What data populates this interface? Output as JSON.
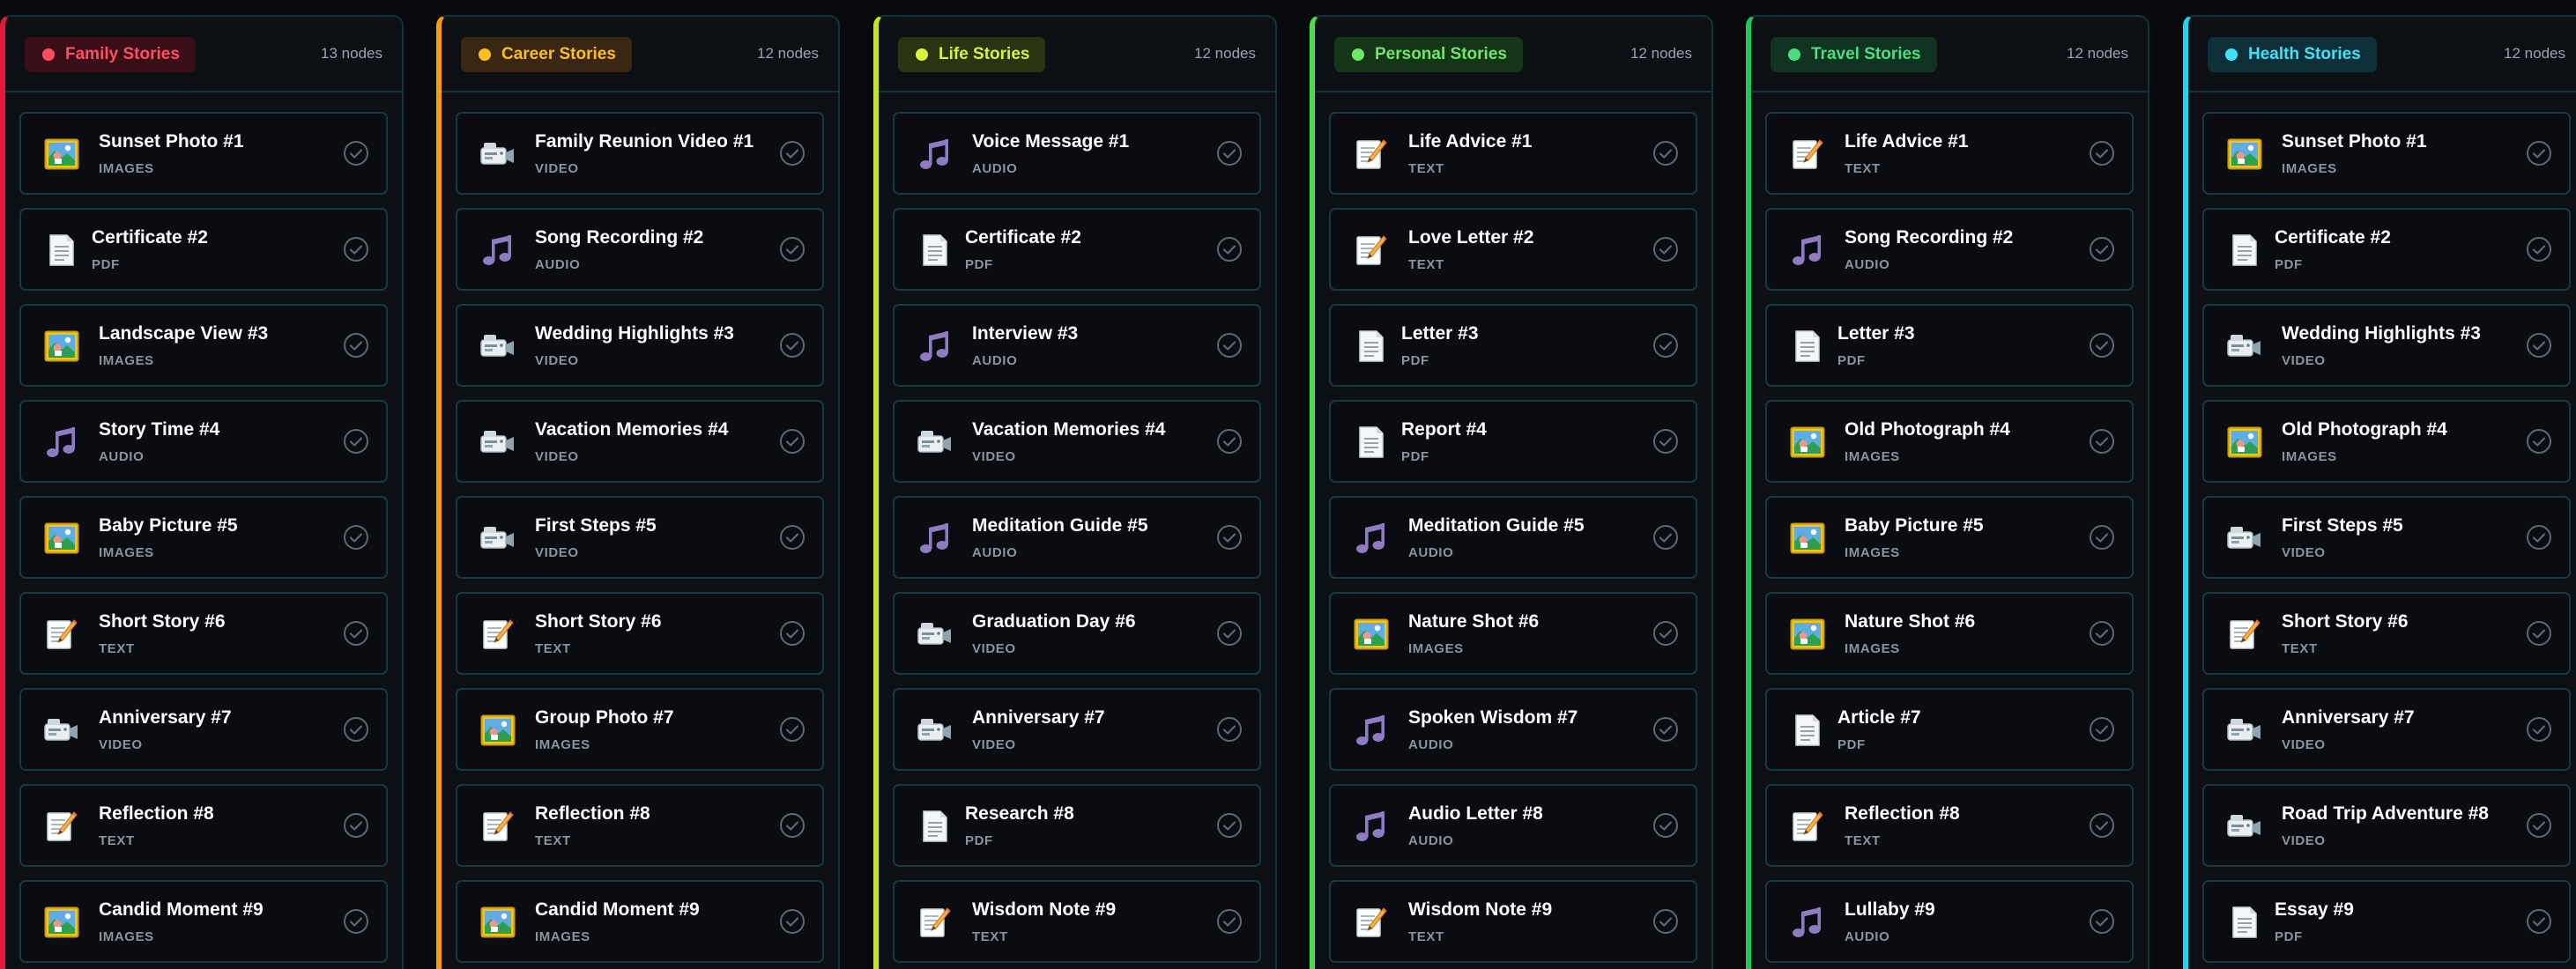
{
  "colors": {
    "text_type": "#8b939c",
    "card_border": "#143a40",
    "column_border": "#10333a"
  },
  "columns": [
    {
      "title": "Family Stories",
      "count": "13 nodes",
      "accent": "#e5173d",
      "pill_bg": "#3a0e16",
      "pill_text": "#ff4d66",
      "cards": [
        {
          "title": "Sunset Photo #1",
          "type": "IMAGES",
          "icon": "image-icon"
        },
        {
          "title": "Certificate #2",
          "type": "PDF",
          "icon": "document-icon"
        },
        {
          "title": "Landscape View #3",
          "type": "IMAGES",
          "icon": "image-icon"
        },
        {
          "title": "Story Time #4",
          "type": "AUDIO",
          "icon": "music-note-icon"
        },
        {
          "title": "Baby Picture #5",
          "type": "IMAGES",
          "icon": "image-icon"
        },
        {
          "title": "Short Story #6",
          "type": "TEXT",
          "icon": "memo-icon"
        },
        {
          "title": "Anniversary #7",
          "type": "VIDEO",
          "icon": "video-camera-icon"
        },
        {
          "title": "Reflection #8",
          "type": "TEXT",
          "icon": "memo-icon"
        },
        {
          "title": "Candid Moment #9",
          "type": "IMAGES",
          "icon": "image-icon"
        }
      ]
    },
    {
      "title": "Career Stories",
      "count": "12 nodes",
      "accent": "#f59e0b",
      "pill_bg": "#3a2712",
      "pill_text": "#fbbf24",
      "cards": [
        {
          "title": "Family Reunion Video #1",
          "type": "VIDEO",
          "icon": "video-camera-icon"
        },
        {
          "title": "Song Recording #2",
          "type": "AUDIO",
          "icon": "music-note-icon"
        },
        {
          "title": "Wedding Highlights #3",
          "type": "VIDEO",
          "icon": "video-camera-icon"
        },
        {
          "title": "Vacation Memories #4",
          "type": "VIDEO",
          "icon": "video-camera-icon"
        },
        {
          "title": "First Steps #5",
          "type": "VIDEO",
          "icon": "video-camera-icon"
        },
        {
          "title": "Short Story #6",
          "type": "TEXT",
          "icon": "memo-icon"
        },
        {
          "title": "Group Photo #7",
          "type": "IMAGES",
          "icon": "image-icon"
        },
        {
          "title": "Reflection #8",
          "type": "TEXT",
          "icon": "memo-icon"
        },
        {
          "title": "Candid Moment #9",
          "type": "IMAGES",
          "icon": "image-icon"
        }
      ]
    },
    {
      "title": "Life Stories",
      "count": "12 nodes",
      "accent": "#c6e619",
      "pill_bg": "#2a3410",
      "pill_text": "#d9f23a",
      "cards": [
        {
          "title": "Voice Message #1",
          "type": "AUDIO",
          "icon": "music-note-icon"
        },
        {
          "title": "Certificate #2",
          "type": "PDF",
          "icon": "document-icon"
        },
        {
          "title": "Interview #3",
          "type": "AUDIO",
          "icon": "music-note-icon"
        },
        {
          "title": "Vacation Memories #4",
          "type": "VIDEO",
          "icon": "video-camera-icon"
        },
        {
          "title": "Meditation Guide #5",
          "type": "AUDIO",
          "icon": "music-note-icon"
        },
        {
          "title": "Graduation Day #6",
          "type": "VIDEO",
          "icon": "video-camera-icon"
        },
        {
          "title": "Anniversary #7",
          "type": "VIDEO",
          "icon": "video-camera-icon"
        },
        {
          "title": "Research #8",
          "type": "PDF",
          "icon": "document-icon"
        },
        {
          "title": "Wisdom Note #9",
          "type": "TEXT",
          "icon": "memo-icon"
        }
      ]
    },
    {
      "title": "Personal Stories",
      "count": "12 nodes",
      "accent": "#4ade4a",
      "pill_bg": "#163418",
      "pill_text": "#6ee76a",
      "cards": [
        {
          "title": "Life Advice #1",
          "type": "TEXT",
          "icon": "memo-icon"
        },
        {
          "title": "Love Letter #2",
          "type": "TEXT",
          "icon": "memo-icon"
        },
        {
          "title": "Letter #3",
          "type": "PDF",
          "icon": "document-icon"
        },
        {
          "title": "Report #4",
          "type": "PDF",
          "icon": "document-icon"
        },
        {
          "title": "Meditation Guide #5",
          "type": "AUDIO",
          "icon": "music-note-icon"
        },
        {
          "title": "Nature Shot #6",
          "type": "IMAGES",
          "icon": "image-icon"
        },
        {
          "title": "Spoken Wisdom #7",
          "type": "AUDIO",
          "icon": "music-note-icon"
        },
        {
          "title": "Audio Letter #8",
          "type": "AUDIO",
          "icon": "music-note-icon"
        },
        {
          "title": "Wisdom Note #9",
          "type": "TEXT",
          "icon": "memo-icon"
        }
      ]
    },
    {
      "title": "Travel Stories",
      "count": "12 nodes",
      "accent": "#22c55e",
      "pill_bg": "#0f3320",
      "pill_text": "#4ade80",
      "cards": [
        {
          "title": "Life Advice #1",
          "type": "TEXT",
          "icon": "memo-icon"
        },
        {
          "title": "Song Recording #2",
          "type": "AUDIO",
          "icon": "music-note-icon"
        },
        {
          "title": "Letter #3",
          "type": "PDF",
          "icon": "document-icon"
        },
        {
          "title": "Old Photograph #4",
          "type": "IMAGES",
          "icon": "image-icon"
        },
        {
          "title": "Baby Picture #5",
          "type": "IMAGES",
          "icon": "image-icon"
        },
        {
          "title": "Nature Shot #6",
          "type": "IMAGES",
          "icon": "image-icon"
        },
        {
          "title": "Article #7",
          "type": "PDF",
          "icon": "document-icon"
        },
        {
          "title": "Reflection #8",
          "type": "TEXT",
          "icon": "memo-icon"
        },
        {
          "title": "Lullaby #9",
          "type": "AUDIO",
          "icon": "music-note-icon"
        }
      ]
    },
    {
      "title": "Health Stories",
      "count": "12 nodes",
      "accent": "#22d3ee",
      "pill_bg": "#0d3038",
      "pill_text": "#40e0f5",
      "cards": [
        {
          "title": "Sunset Photo #1",
          "type": "IMAGES",
          "icon": "image-icon"
        },
        {
          "title": "Certificate #2",
          "type": "PDF",
          "icon": "document-icon"
        },
        {
          "title": "Wedding Highlights #3",
          "type": "VIDEO",
          "icon": "video-camera-icon"
        },
        {
          "title": "Old Photograph #4",
          "type": "IMAGES",
          "icon": "image-icon"
        },
        {
          "title": "First Steps #5",
          "type": "VIDEO",
          "icon": "video-camera-icon"
        },
        {
          "title": "Short Story #6",
          "type": "TEXT",
          "icon": "memo-icon"
        },
        {
          "title": "Anniversary #7",
          "type": "VIDEO",
          "icon": "video-camera-icon"
        },
        {
          "title": "Road Trip Adventure #8",
          "type": "VIDEO",
          "icon": "video-camera-icon"
        },
        {
          "title": "Essay #9",
          "type": "PDF",
          "icon": "document-icon"
        }
      ]
    }
  ]
}
